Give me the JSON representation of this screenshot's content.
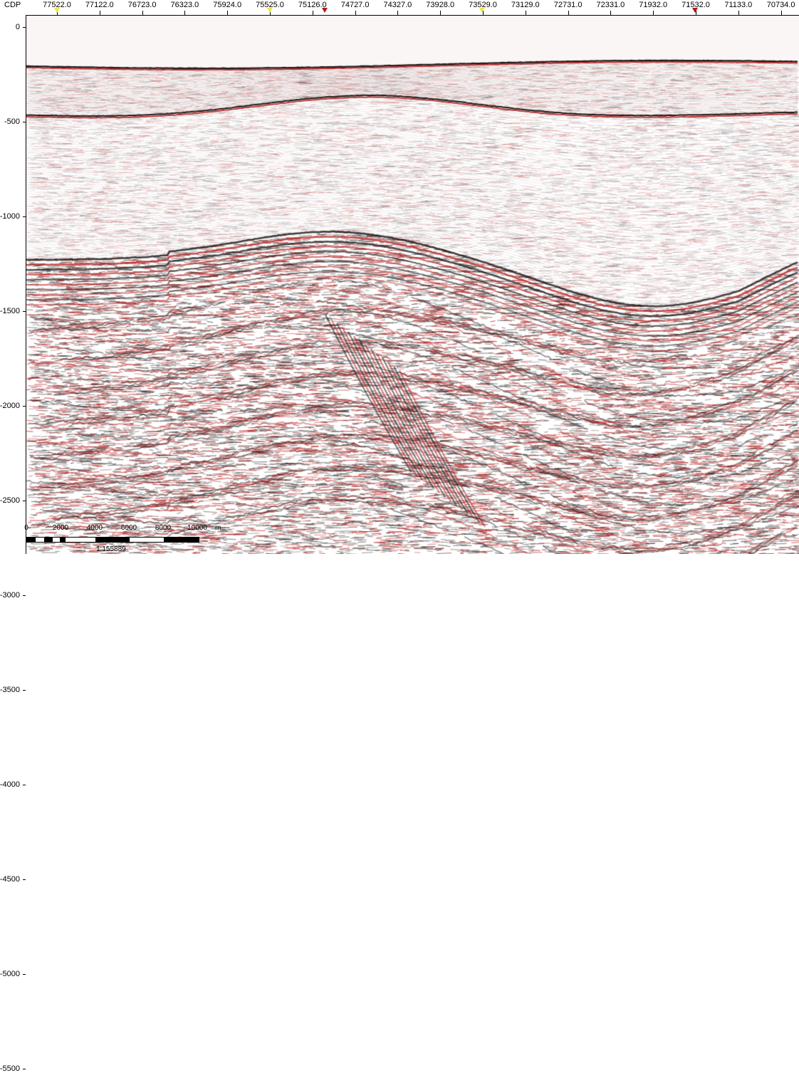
{
  "top_axis": {
    "label": "CDP",
    "ticks": [
      "77522.0",
      "77122.0",
      "76723.0",
      "76323.0",
      "75924.0",
      "75525.0",
      "75126.0",
      "74727.0",
      "74327.0",
      "73928.0",
      "73529.0",
      "73129.0",
      "72731.0",
      "72331.0",
      "71932.0",
      "71532.0",
      "71133.0",
      "70734.0"
    ],
    "markers": [
      {
        "name": "well-marker-1",
        "color": "yellow",
        "cdp": 77522.0
      },
      {
        "name": "well-marker-2",
        "color": "yellow",
        "cdp": 75525.0
      },
      {
        "name": "well-marker-3",
        "color": "red",
        "cdp": 75006.0
      },
      {
        "name": "well-marker-4",
        "color": "yellow",
        "cdp": 73529.0
      },
      {
        "name": "well-marker-5",
        "color": "red",
        "cdp": 71532.0
      }
    ]
  },
  "left_axis": {
    "ticks": [
      "0",
      "-500",
      "-1000",
      "-1500",
      "-2000",
      "-2500",
      "-3000",
      "-3500",
      "-4000",
      "-4500",
      "-5000",
      "-5500"
    ]
  },
  "scale_bar": {
    "labels": [
      "0",
      "2000",
      "4000",
      "6000",
      "8000",
      "10000"
    ],
    "unit": "m",
    "ratio": "1:155889"
  },
  "colors": {
    "positive_amplitude": "#b41e1e",
    "negative_amplitude": "#1a1a1a",
    "background": "#ffffff",
    "water": "#fbf6f6"
  }
}
